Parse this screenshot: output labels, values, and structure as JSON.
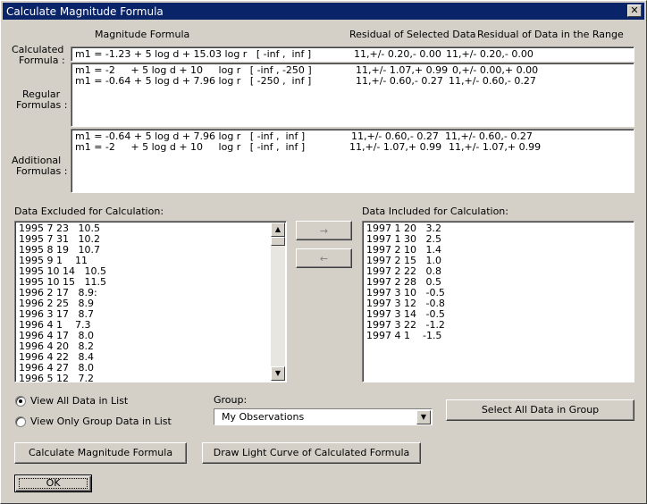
{
  "window": {
    "title": "Calculate Magnitude Formula",
    "close_glyph": "✕"
  },
  "headers": {
    "magnitude_formula": "Magnitude Formula",
    "residual_selected": "Residual of Selected Data",
    "residual_range": "Residual of Data in the Range"
  },
  "calculated": {
    "label_line1": "Calculated",
    "label_line2": "Formula :",
    "rows": [
      {
        "formula": "m1 = -1.23 + 5 log d + 15.03 log r   [ -inf ,  inf ]",
        "sel": "11,+/- 0.20,- 0.00",
        "range": "11,+/- 0.20,- 0.00"
      }
    ]
  },
  "regular": {
    "label_line1": "Regular",
    "label_line2": "Formulas :",
    "rows": [
      {
        "formula": "m1 = -2     + 5 log d + 10     log r   [ -inf , -250 ]",
        "sel": "11,+/- 1.07,+ 0.99",
        "range": "0,+/- 0.00,+ 0.00"
      },
      {
        "formula": "m1 = -0.64 + 5 log d + 7.96 log r   [ -250 ,  inf ]",
        "sel": "11,+/- 0.60,- 0.27",
        "range": "11,+/- 0.60,- 0.27"
      }
    ]
  },
  "additional": {
    "label_line1": "Additional",
    "label_line2": "Formulas :",
    "rows": [
      {
        "formula": "m1 = -0.64 + 5 log d + 7.96 log r   [ -inf ,  inf ]",
        "sel": "11,+/- 0.60,- 0.27",
        "range": "11,+/- 0.60,- 0.27"
      },
      {
        "formula": "m1 = -2     + 5 log d + 10     log r   [ -inf ,  inf ]",
        "sel": "11,+/- 1.07,+ 0.99",
        "range": "11,+/- 1.07,+ 0.99"
      }
    ]
  },
  "excluded": {
    "label": "Data Excluded for Calculation:",
    "items": [
      "1995 7 23   10.5",
      "1995 7 31   10.2",
      "1995 8 19   10.7",
      "1995 9 1    11",
      "1995 10 14   10.5",
      "1995 10 15   11.5",
      "1996 2 17   8.9:",
      "1996 2 25   8.9",
      "1996 3 17   8.7",
      "1996 4 1    7.3",
      "1996 4 17   8.0",
      "1996 4 20   8.2",
      "1996 4 22   8.4",
      "1996 4 27   8.0",
      "1996 5 12   7.2"
    ]
  },
  "included": {
    "label": "Data Included for Calculation:",
    "items": [
      "1997 1 20   3.2",
      "1997 1 30   2.5",
      "1997 2 10   1.4",
      "1997 2 15   1.0",
      "1997 2 22   0.8",
      "1997 2 28   0.5",
      "1997 3 10   -0.5",
      "1997 3 12   -0.8",
      "1997 3 14   -0.5",
      "1997 3 22   -1.2",
      "1997 4 1    -1.5"
    ]
  },
  "move": {
    "right": "→",
    "left": "←"
  },
  "view": {
    "all_label": "View All Data in List",
    "group_label": "View Only Group Data in List",
    "selected": "all"
  },
  "group": {
    "label": "Group:",
    "value": "My Observations",
    "select_all": "Select All Data in Group"
  },
  "actions": {
    "calculate": "Calculate Magnitude Formula",
    "draw": "Draw Light Curve of Calculated Formula",
    "ok": "OK"
  }
}
